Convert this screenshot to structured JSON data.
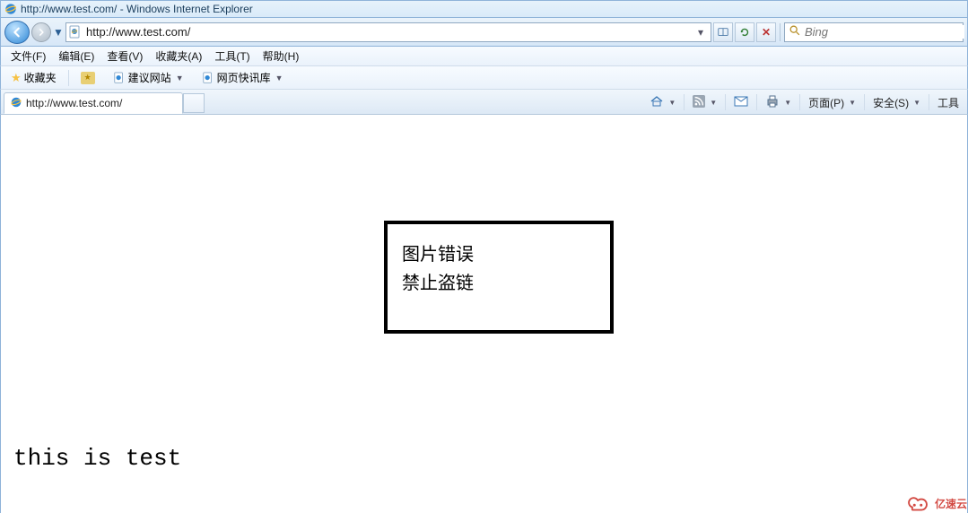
{
  "window": {
    "title": "http://www.test.com/ - Windows Internet Explorer"
  },
  "address": {
    "url": "http://www.test.com/"
  },
  "search": {
    "placeholder": "Bing"
  },
  "menu": {
    "file": "文件(F)",
    "edit": "编辑(E)",
    "view": "查看(V)",
    "favorites": "收藏夹(A)",
    "tools": "工具(T)",
    "help": "帮助(H)"
  },
  "favbar": {
    "favorites_label": "收藏夹",
    "suggested_sites": "建议网站",
    "web_slice_gallery": "网页快讯库"
  },
  "tab": {
    "title": "http://www.test.com/"
  },
  "commands": {
    "page": "页面(P)",
    "safety": "安全(S)",
    "tools": "工具"
  },
  "content": {
    "error_line1": "图片错误",
    "error_line2": "禁止盗链",
    "body_text": "this is test"
  },
  "watermark": {
    "text": "亿速云"
  }
}
